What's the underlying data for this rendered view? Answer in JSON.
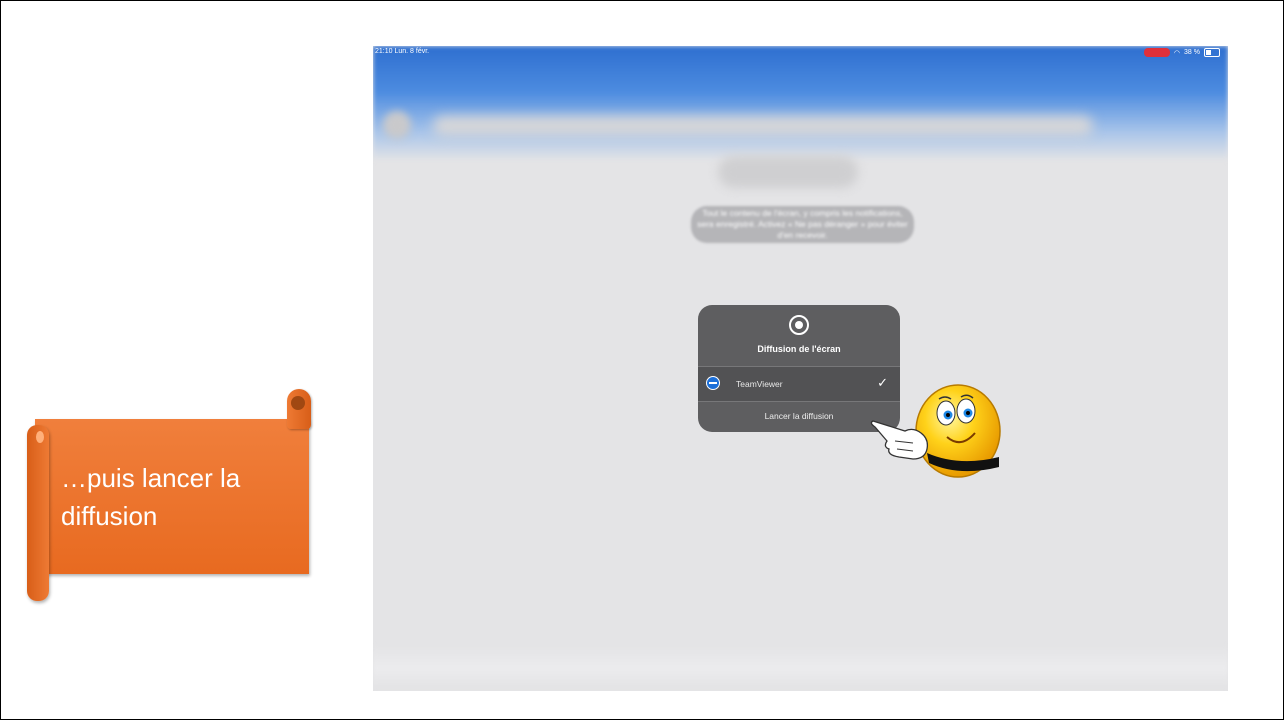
{
  "callout": {
    "text": "…puis lancer la diffusion"
  },
  "status_bar": {
    "time_date": "21:10  Lun. 8 févr.",
    "battery": "38 %"
  },
  "blurred_notice": "Tout le contenu de l'écran, y compris les notifications, sera enregistré. Activez « Ne pas déranger » pour éviter d'en recevoir.",
  "modal": {
    "icon": "record-icon",
    "title": "Diffusion de l'écran",
    "option_label": "TeamViewer",
    "option_checked": true,
    "action_label": "Lancer la diffusion"
  },
  "colors": {
    "callout_orange": "#ee7430",
    "modal_bg": "#5e5e60",
    "status_blue": "#2e6fd0"
  }
}
